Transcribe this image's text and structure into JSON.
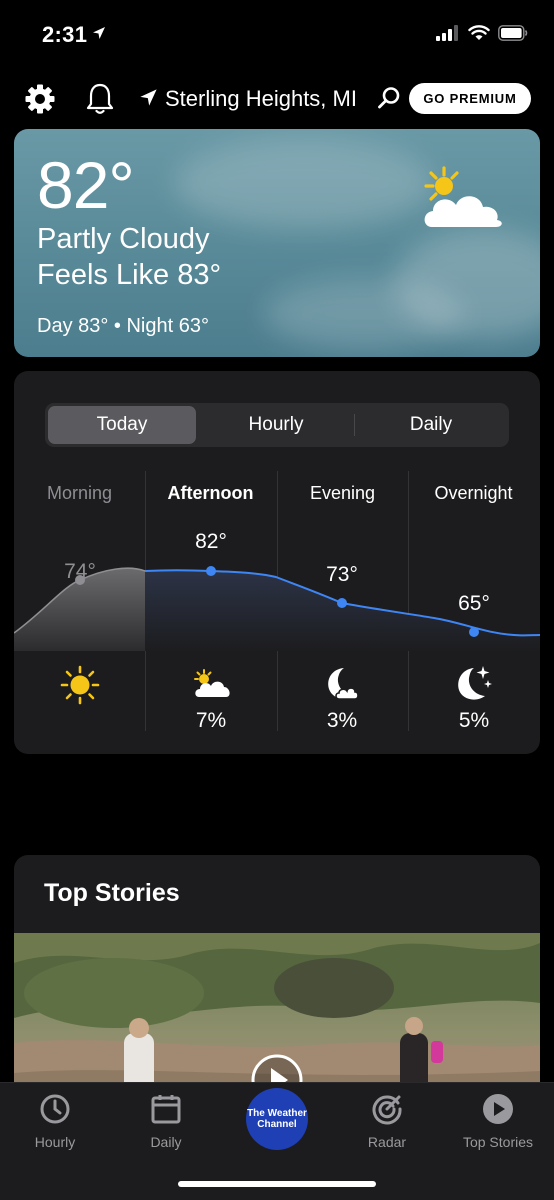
{
  "status_bar": {
    "time": "2:31"
  },
  "header": {
    "location": "Sterling Heights, MI",
    "premium_label": "GO PREMIUM"
  },
  "current": {
    "temperature": "82°",
    "condition": "Partly Cloudy",
    "feels_like": "Feels Like 83°",
    "day_night": "Day 83° • Night 63°",
    "icon": "partly-cloudy-icon"
  },
  "forecast": {
    "tabs": [
      {
        "label": "Today",
        "active": true
      },
      {
        "label": "Hourly",
        "active": false
      },
      {
        "label": "Daily",
        "active": false
      }
    ],
    "periods": [
      {
        "label": "Morning",
        "temp": "74°",
        "icon": "sun-icon",
        "precip": ""
      },
      {
        "label": "Afternoon",
        "temp": "82°",
        "icon": "partly-cloudy-icon",
        "precip": "7%"
      },
      {
        "label": "Evening",
        "temp": "73°",
        "icon": "moon-cloud-icon",
        "precip": "3%"
      },
      {
        "label": "Overnight",
        "temp": "65°",
        "icon": "moon-stars-icon",
        "precip": "5%"
      }
    ]
  },
  "stories": {
    "title": "Top Stories"
  },
  "tabbar": {
    "items": [
      {
        "label": "Hourly",
        "icon": "clock-icon"
      },
      {
        "label": "Daily",
        "icon": "calendar-icon"
      },
      {
        "label": "The Weather Channel",
        "icon": "twc-logo"
      },
      {
        "label": "Radar",
        "icon": "radar-icon"
      },
      {
        "label": "Top Stories",
        "icon": "play-icon"
      }
    ]
  },
  "colors": {
    "accent_blue": "#3f86f5",
    "sun_yellow": "#f5c518",
    "card_bg": "#1c1c1e"
  }
}
